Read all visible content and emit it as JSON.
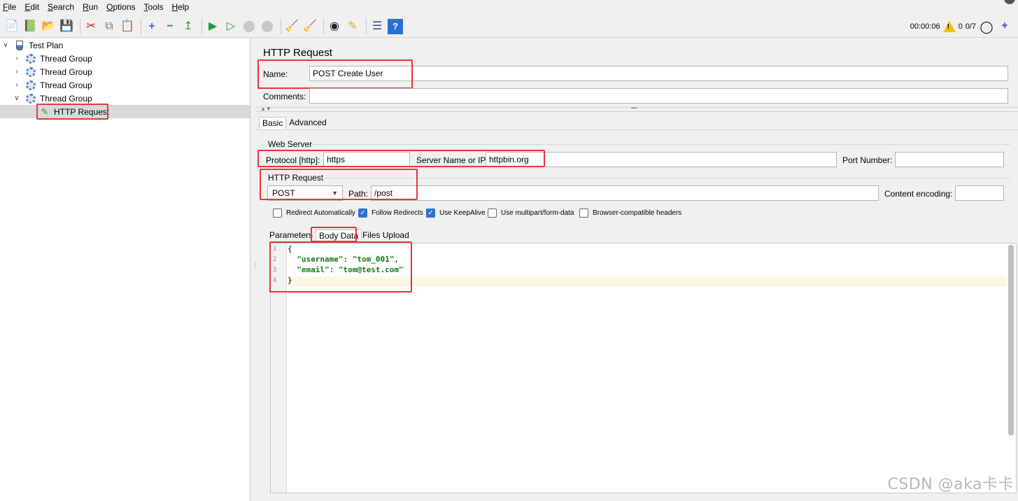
{
  "menu": [
    "File",
    "Edit",
    "Search",
    "Run",
    "Options",
    "Tools",
    "Help"
  ],
  "toolbar": {
    "elapsed": "00:00:06",
    "warning_count": "0",
    "threads": "0/7",
    "icons": [
      "new-icon",
      "templates-icon",
      "open-icon",
      "save-icon",
      "cut-icon",
      "copy-icon",
      "paste-icon",
      "expand-icon",
      "collapse-icon",
      "toggle-icon",
      "start-icon",
      "start-no-pause-icon",
      "stop-icon",
      "shutdown-icon",
      "clear-icon",
      "clear-all-icon",
      "search-icon",
      "reset-search-icon",
      "function-helper-icon",
      "help-icon"
    ]
  },
  "tree": {
    "root": "Test Plan",
    "groups": [
      "Thread Group",
      "Thread Group",
      "Thread Group",
      "Thread Group"
    ],
    "selected": "HTTP Request"
  },
  "panel": {
    "title": "HTTP Request",
    "name_label": "Name:",
    "name_value": "POST Create User",
    "comments_label": "Comments:",
    "comments_value": "",
    "tabs": [
      "Basic",
      "Advanced"
    ],
    "web_server": {
      "legend": "Web Server",
      "protocol_label": "Protocol [http]:",
      "protocol_value": "https",
      "server_label": "Server Name or IP:",
      "server_value": "httpbin.org",
      "port_label": "Port Number:",
      "port_value": ""
    },
    "http_request": {
      "legend": "HTTP Request",
      "method": "POST",
      "path_label": "Path:",
      "path_value": "/post",
      "encoding_label": "Content encoding:",
      "encoding_value": ""
    },
    "options": [
      {
        "label": "Redirect Automatically",
        "checked": false
      },
      {
        "label": "Follow Redirects",
        "checked": true
      },
      {
        "label": "Use KeepAlive",
        "checked": true
      },
      {
        "label": "Use multipart/form-data",
        "checked": false
      },
      {
        "label": "Browser-compatible headers",
        "checked": false
      }
    ],
    "data_tabs": [
      "Parameters",
      "Body Data",
      "Files Upload"
    ],
    "body": {
      "line_numbers": [
        "1",
        "2",
        "3",
        "4"
      ],
      "line1": "{",
      "line2_key": "\"username\"",
      "line2_sep": ": ",
      "line2_val": "\"tom_001\"",
      "line2_end": ",",
      "line3_key": "\"email\"",
      "line3_sep": ": ",
      "line3_val": "\"tom@test.com\"",
      "line4": "}"
    }
  },
  "watermark": "CSDN @aka卡卡",
  "colors": {
    "highlight_box": "#e8353b",
    "selection": "#d9d9d9",
    "string": "#117a11"
  }
}
